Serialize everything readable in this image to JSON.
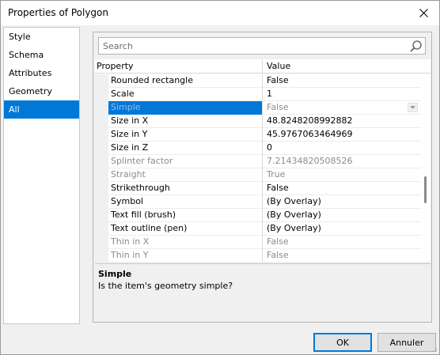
{
  "window": {
    "title": "Properties of Polygon"
  },
  "sidebar": {
    "items": [
      {
        "label": "Style"
      },
      {
        "label": "Schema"
      },
      {
        "label": "Attributes"
      },
      {
        "label": "Geometry"
      },
      {
        "label": "All",
        "selected": true
      }
    ]
  },
  "search": {
    "placeholder": "Search",
    "value": ""
  },
  "grid": {
    "columns": [
      "Property",
      "Value"
    ],
    "rows": [
      {
        "property": "Rounded rectangle",
        "value": "False",
        "state": "normal"
      },
      {
        "property": "Scale",
        "value": "1",
        "state": "normal"
      },
      {
        "property": "Simple",
        "value": "False",
        "state": "selected"
      },
      {
        "property": "Size in X",
        "value": "48.8248208992882",
        "state": "normal"
      },
      {
        "property": "Size in Y",
        "value": "45.9767063464969",
        "state": "normal"
      },
      {
        "property": "Size in Z",
        "value": "0",
        "state": "normal"
      },
      {
        "property": "Splinter factor",
        "value": "7.21434820508526",
        "state": "disabled"
      },
      {
        "property": "Straight",
        "value": "True",
        "state": "disabled"
      },
      {
        "property": "Strikethrough",
        "value": "False",
        "state": "normal"
      },
      {
        "property": "Symbol",
        "value": " (By Overlay)",
        "state": "normal"
      },
      {
        "property": "Text fill (brush)",
        "value": " (By Overlay)",
        "state": "normal"
      },
      {
        "property": "Text outline (pen)",
        "value": " (By Overlay)",
        "state": "normal"
      },
      {
        "property": "Thin in X",
        "value": "False",
        "state": "disabled"
      },
      {
        "property": "Thin in Y",
        "value": "False",
        "state": "disabled"
      }
    ]
  },
  "description": {
    "title": "Simple",
    "text": "Is the item's geometry simple?"
  },
  "buttons": {
    "ok": "OK",
    "cancel": "Annuler"
  },
  "colors": {
    "accent": "#0078d7",
    "dialog_bg": "#f0f0f0",
    "disabled_text": "#8c8c8c"
  },
  "icons": {
    "search": "search-icon",
    "close": "close-icon",
    "dropdown": "chevron-down-icon"
  }
}
